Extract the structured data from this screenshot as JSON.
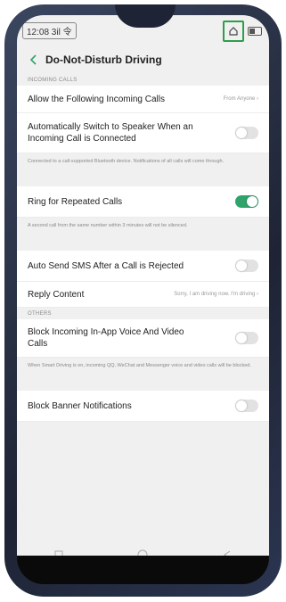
{
  "status": {
    "time": "12:08 3il 令"
  },
  "header": {
    "title": "Do-Not-Disturb Driving"
  },
  "sections": {
    "incoming": "INCOMING CALLS",
    "others": "OTHERS"
  },
  "rows": {
    "allow_calls": {
      "label": "Allow the Following Incoming Calls",
      "value": "From Anyone ›"
    },
    "auto_speaker": {
      "label": "Automatically Switch to Speaker When an Incoming Call is Connected",
      "on": false
    },
    "auto_speaker_desc": "Connected to a call-supported Bluetooth device. Notifications of all calls will come through.",
    "ring_repeated": {
      "label": "Ring for Repeated Calls",
      "on": true
    },
    "ring_repeated_desc": "A second call from the same number within 3 minutes will not be silenced.",
    "auto_sms": {
      "label": "Auto Send SMS After a Call is Rejected",
      "on": false
    },
    "reply_content": {
      "label": "Reply Content",
      "value": "Sorry, I am driving now. I'm driving ›"
    },
    "block_inapp": {
      "label": "Block Incoming In-App Voice And Video Calls",
      "on": false
    },
    "block_inapp_desc": "When Smart Driving is on, incoming QQ, WeChat and Messenger voice and video calls will be blocked.",
    "block_banner": {
      "label": "Block Banner Notifications",
      "on": false
    }
  },
  "colors": {
    "accent": "#2fa36b",
    "highlight": "#2e9e4a"
  }
}
